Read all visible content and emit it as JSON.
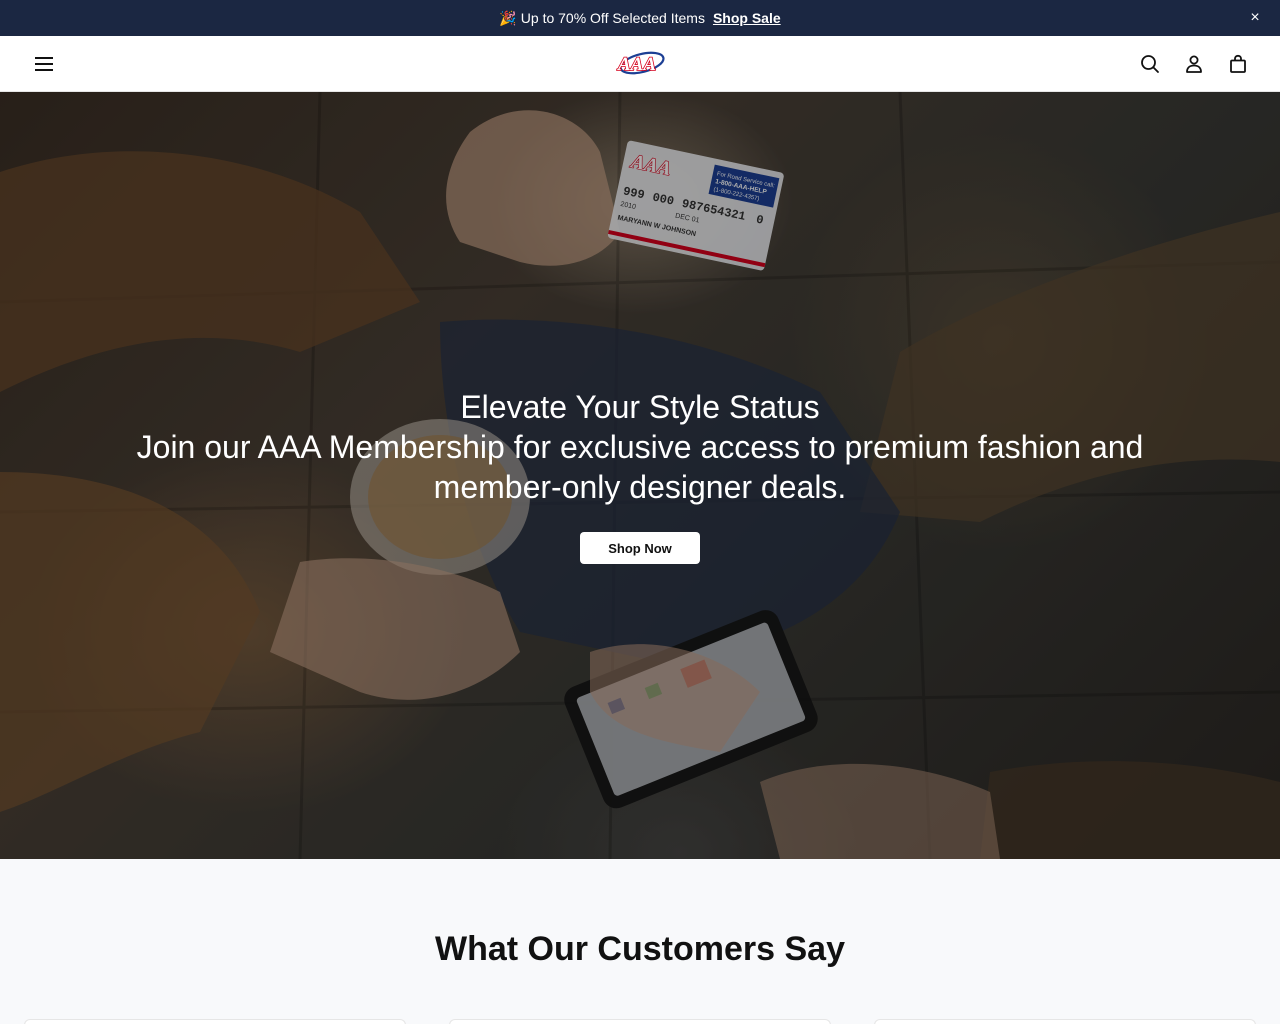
{
  "announcement": {
    "emoji": "🎉",
    "text": "Up to 70% Off Selected Items",
    "link_label": "Shop Sale",
    "close_glyph": "×",
    "background": "#1b2742"
  },
  "header": {
    "menu_icon": "hamburger-menu-icon",
    "logo": "AAA",
    "icons": [
      "search-icon",
      "account-icon",
      "shopping-bag-icon"
    ]
  },
  "hero": {
    "title": "Elevate Your Style Status",
    "subtitle": "Join our AAA Membership for exclusive access to premium fashion and member-only designer deals.",
    "button_label": "Shop Now",
    "card": {
      "number_a": "999",
      "number_b": "000",
      "number_c": "987654321",
      "number_d": "0",
      "name": "MARYANN W JOHNSON",
      "since": "2010",
      "exp": "DEC 01",
      "service_line1": "For Road Service call:",
      "service_line2": "1-800-AAA-HELP",
      "service_line3": "(1-800-222-4357)"
    }
  },
  "testimonials": {
    "heading": "What Our Customers Say"
  },
  "colors": {
    "aaa_red": "#d6001c",
    "aaa_blue": "#1c3f94"
  }
}
